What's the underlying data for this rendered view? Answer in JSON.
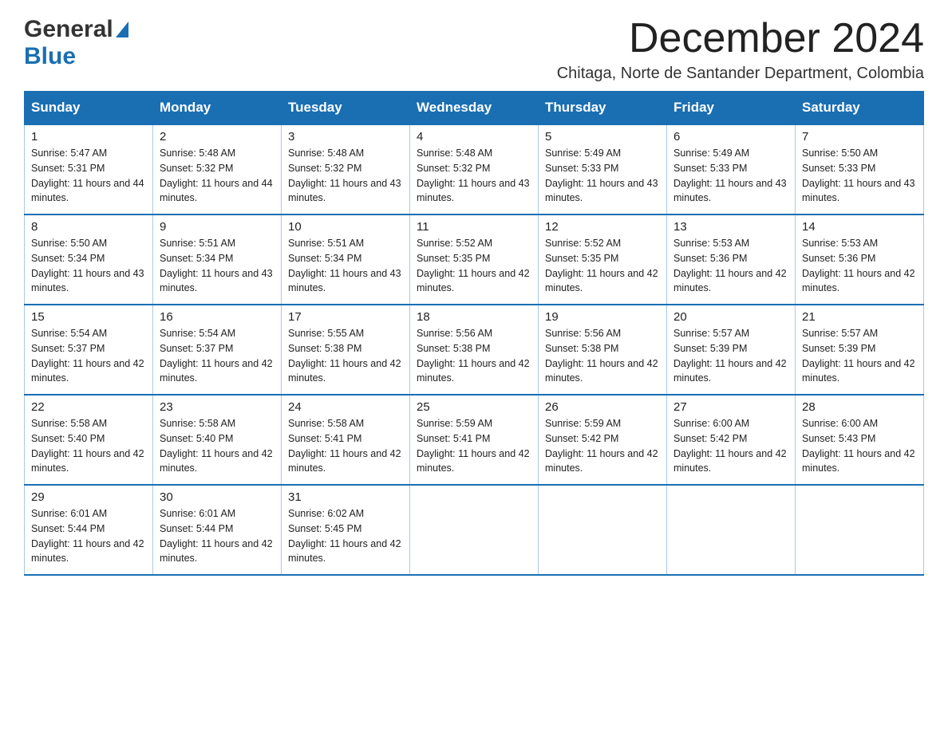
{
  "header": {
    "logo_general": "General",
    "logo_blue": "Blue",
    "month_title": "December 2024",
    "subtitle": "Chitaga, Norte de Santander Department, Colombia"
  },
  "days_of_week": [
    "Sunday",
    "Monday",
    "Tuesday",
    "Wednesday",
    "Thursday",
    "Friday",
    "Saturday"
  ],
  "weeks": [
    [
      {
        "day": "1",
        "sunrise": "Sunrise: 5:47 AM",
        "sunset": "Sunset: 5:31 PM",
        "daylight": "Daylight: 11 hours and 44 minutes."
      },
      {
        "day": "2",
        "sunrise": "Sunrise: 5:48 AM",
        "sunset": "Sunset: 5:32 PM",
        "daylight": "Daylight: 11 hours and 44 minutes."
      },
      {
        "day": "3",
        "sunrise": "Sunrise: 5:48 AM",
        "sunset": "Sunset: 5:32 PM",
        "daylight": "Daylight: 11 hours and 43 minutes."
      },
      {
        "day": "4",
        "sunrise": "Sunrise: 5:48 AM",
        "sunset": "Sunset: 5:32 PM",
        "daylight": "Daylight: 11 hours and 43 minutes."
      },
      {
        "day": "5",
        "sunrise": "Sunrise: 5:49 AM",
        "sunset": "Sunset: 5:33 PM",
        "daylight": "Daylight: 11 hours and 43 minutes."
      },
      {
        "day": "6",
        "sunrise": "Sunrise: 5:49 AM",
        "sunset": "Sunset: 5:33 PM",
        "daylight": "Daylight: 11 hours and 43 minutes."
      },
      {
        "day": "7",
        "sunrise": "Sunrise: 5:50 AM",
        "sunset": "Sunset: 5:33 PM",
        "daylight": "Daylight: 11 hours and 43 minutes."
      }
    ],
    [
      {
        "day": "8",
        "sunrise": "Sunrise: 5:50 AM",
        "sunset": "Sunset: 5:34 PM",
        "daylight": "Daylight: 11 hours and 43 minutes."
      },
      {
        "day": "9",
        "sunrise": "Sunrise: 5:51 AM",
        "sunset": "Sunset: 5:34 PM",
        "daylight": "Daylight: 11 hours and 43 minutes."
      },
      {
        "day": "10",
        "sunrise": "Sunrise: 5:51 AM",
        "sunset": "Sunset: 5:34 PM",
        "daylight": "Daylight: 11 hours and 43 minutes."
      },
      {
        "day": "11",
        "sunrise": "Sunrise: 5:52 AM",
        "sunset": "Sunset: 5:35 PM",
        "daylight": "Daylight: 11 hours and 42 minutes."
      },
      {
        "day": "12",
        "sunrise": "Sunrise: 5:52 AM",
        "sunset": "Sunset: 5:35 PM",
        "daylight": "Daylight: 11 hours and 42 minutes."
      },
      {
        "day": "13",
        "sunrise": "Sunrise: 5:53 AM",
        "sunset": "Sunset: 5:36 PM",
        "daylight": "Daylight: 11 hours and 42 minutes."
      },
      {
        "day": "14",
        "sunrise": "Sunrise: 5:53 AM",
        "sunset": "Sunset: 5:36 PM",
        "daylight": "Daylight: 11 hours and 42 minutes."
      }
    ],
    [
      {
        "day": "15",
        "sunrise": "Sunrise: 5:54 AM",
        "sunset": "Sunset: 5:37 PM",
        "daylight": "Daylight: 11 hours and 42 minutes."
      },
      {
        "day": "16",
        "sunrise": "Sunrise: 5:54 AM",
        "sunset": "Sunset: 5:37 PM",
        "daylight": "Daylight: 11 hours and 42 minutes."
      },
      {
        "day": "17",
        "sunrise": "Sunrise: 5:55 AM",
        "sunset": "Sunset: 5:38 PM",
        "daylight": "Daylight: 11 hours and 42 minutes."
      },
      {
        "day": "18",
        "sunrise": "Sunrise: 5:56 AM",
        "sunset": "Sunset: 5:38 PM",
        "daylight": "Daylight: 11 hours and 42 minutes."
      },
      {
        "day": "19",
        "sunrise": "Sunrise: 5:56 AM",
        "sunset": "Sunset: 5:38 PM",
        "daylight": "Daylight: 11 hours and 42 minutes."
      },
      {
        "day": "20",
        "sunrise": "Sunrise: 5:57 AM",
        "sunset": "Sunset: 5:39 PM",
        "daylight": "Daylight: 11 hours and 42 minutes."
      },
      {
        "day": "21",
        "sunrise": "Sunrise: 5:57 AM",
        "sunset": "Sunset: 5:39 PM",
        "daylight": "Daylight: 11 hours and 42 minutes."
      }
    ],
    [
      {
        "day": "22",
        "sunrise": "Sunrise: 5:58 AM",
        "sunset": "Sunset: 5:40 PM",
        "daylight": "Daylight: 11 hours and 42 minutes."
      },
      {
        "day": "23",
        "sunrise": "Sunrise: 5:58 AM",
        "sunset": "Sunset: 5:40 PM",
        "daylight": "Daylight: 11 hours and 42 minutes."
      },
      {
        "day": "24",
        "sunrise": "Sunrise: 5:58 AM",
        "sunset": "Sunset: 5:41 PM",
        "daylight": "Daylight: 11 hours and 42 minutes."
      },
      {
        "day": "25",
        "sunrise": "Sunrise: 5:59 AM",
        "sunset": "Sunset: 5:41 PM",
        "daylight": "Daylight: 11 hours and 42 minutes."
      },
      {
        "day": "26",
        "sunrise": "Sunrise: 5:59 AM",
        "sunset": "Sunset: 5:42 PM",
        "daylight": "Daylight: 11 hours and 42 minutes."
      },
      {
        "day": "27",
        "sunrise": "Sunrise: 6:00 AM",
        "sunset": "Sunset: 5:42 PM",
        "daylight": "Daylight: 11 hours and 42 minutes."
      },
      {
        "day": "28",
        "sunrise": "Sunrise: 6:00 AM",
        "sunset": "Sunset: 5:43 PM",
        "daylight": "Daylight: 11 hours and 42 minutes."
      }
    ],
    [
      {
        "day": "29",
        "sunrise": "Sunrise: 6:01 AM",
        "sunset": "Sunset: 5:44 PM",
        "daylight": "Daylight: 11 hours and 42 minutes."
      },
      {
        "day": "30",
        "sunrise": "Sunrise: 6:01 AM",
        "sunset": "Sunset: 5:44 PM",
        "daylight": "Daylight: 11 hours and 42 minutes."
      },
      {
        "day": "31",
        "sunrise": "Sunrise: 6:02 AM",
        "sunset": "Sunset: 5:45 PM",
        "daylight": "Daylight: 11 hours and 42 minutes."
      },
      null,
      null,
      null,
      null
    ]
  ]
}
